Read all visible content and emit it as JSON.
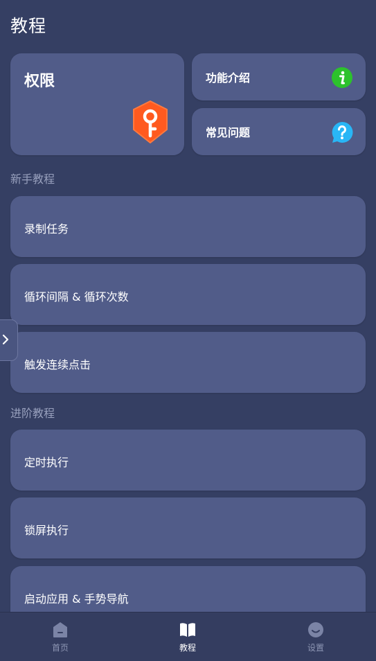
{
  "header": {
    "title": "教程"
  },
  "permission_card": {
    "label": "权限",
    "icon": "key-shield-icon",
    "icon_color": "#ff5a1f"
  },
  "feature_intro": {
    "label": "功能介绍",
    "icon": "info-icon",
    "icon_color": "#2cc22c"
  },
  "faq": {
    "label": "常见问题",
    "icon": "question-bubble-icon",
    "icon_color": "#29b6f6"
  },
  "beginner": {
    "title": "新手教程",
    "items": [
      {
        "label": "录制任务"
      },
      {
        "label": "循环间隔 & 循环次数"
      },
      {
        "label": "触发连续点击"
      }
    ]
  },
  "advanced": {
    "title": "进阶教程",
    "items": [
      {
        "label": "定时执行"
      },
      {
        "label": "锁屏执行"
      },
      {
        "label": "启动应用 & 手势导航"
      }
    ]
  },
  "bottom_nav": {
    "items": [
      {
        "label": "首页",
        "icon": "home-icon",
        "active": false
      },
      {
        "label": "教程",
        "icon": "book-icon",
        "active": true
      },
      {
        "label": "设置",
        "icon": "face-icon",
        "active": false
      }
    ]
  },
  "colors": {
    "background": "#353f63",
    "card": "#515c89",
    "section_text": "#98a0bd",
    "nav_inactive": "#8e96b4"
  }
}
